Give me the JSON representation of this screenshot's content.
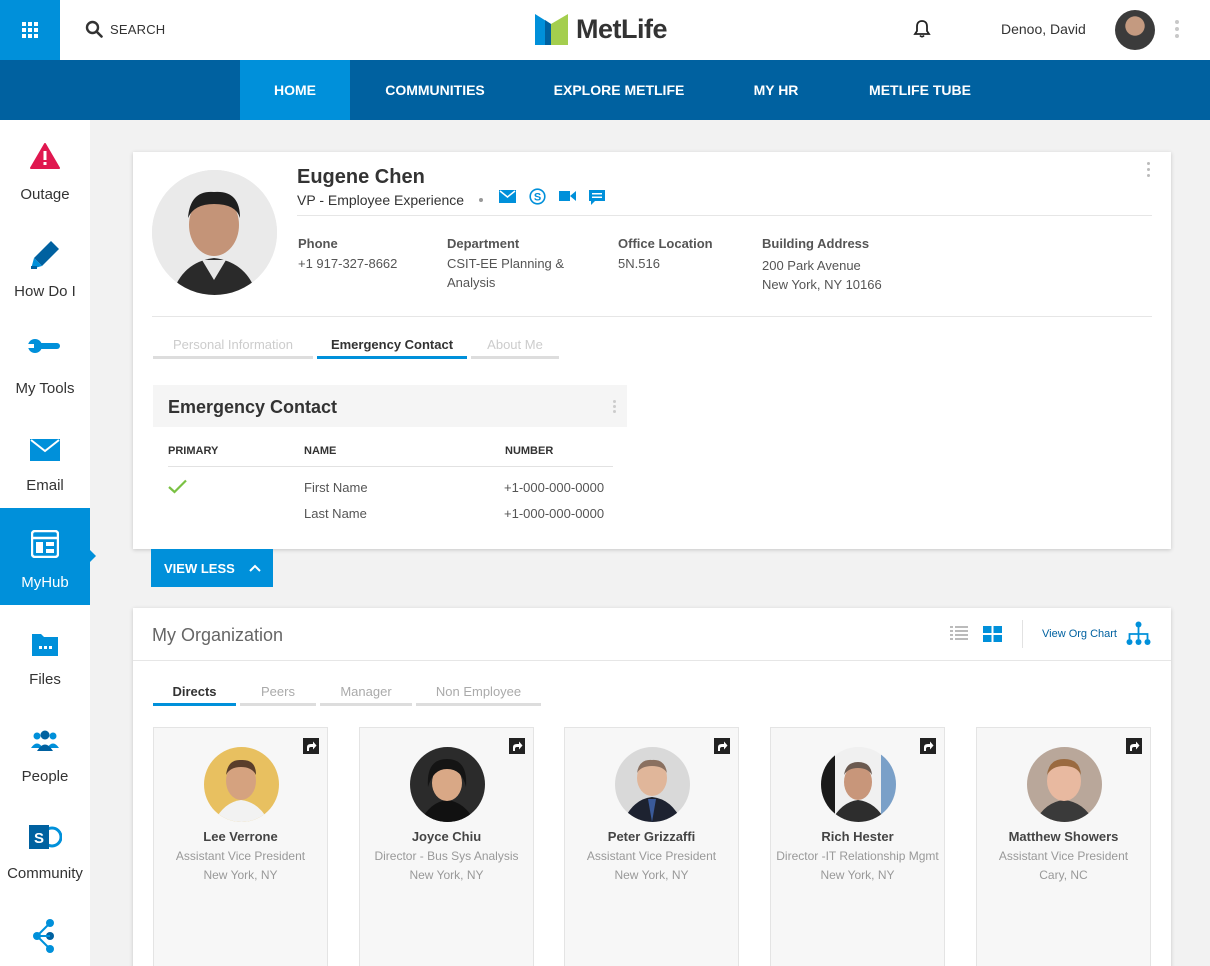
{
  "topbar": {
    "search_label": "SEARCH",
    "brand": "MetLife",
    "user_name": "Denoo, David"
  },
  "nav": {
    "items": [
      "HOME",
      "COMMUNITIES",
      "EXPLORE METLIFE",
      "MY HR",
      "METLIFE TUBE"
    ],
    "active": "HOME"
  },
  "sidebar": {
    "items": [
      {
        "label": "Outage",
        "icon": "warning-icon"
      },
      {
        "label": "How Do I",
        "icon": "pen-icon"
      },
      {
        "label": "My Tools",
        "icon": "wrench-icon"
      },
      {
        "label": "Email",
        "icon": "envelope-icon"
      },
      {
        "label": "MyHub",
        "icon": "hub-icon"
      },
      {
        "label": "Files",
        "icon": "folder-icon"
      },
      {
        "label": "People",
        "icon": "people-icon"
      },
      {
        "label": "Community",
        "icon": "sharepoint-icon"
      },
      {
        "label": "",
        "icon": "network-icon"
      }
    ],
    "active": "MyHub"
  },
  "profile": {
    "name": "Eugene Chen",
    "title": "VP - Employee Experience",
    "phone_label": "Phone",
    "phone": "+1 917-327-8662",
    "department_label": "Department",
    "department_line1": "CSIT-EE  Planning &",
    "department_line2": "Analysis",
    "office_label": "Office Location",
    "office": "5N.516",
    "building_label": "Building Address",
    "building_line1": "200 Park Avenue",
    "building_line2": "New York, NY  10166",
    "tabs": [
      "Personal Information",
      "Emergency Contact",
      "About Me"
    ],
    "active_tab": "Emergency Contact"
  },
  "emergency": {
    "title": "Emergency Contact",
    "headers": {
      "primary": "PRIMARY",
      "name": "NAME",
      "number": "NUMBER"
    },
    "rows": [
      {
        "primary": true,
        "name": "First Name",
        "number": "+1-000-000-0000"
      },
      {
        "primary": false,
        "name": "Last Name",
        "number": "+1-000-000-0000"
      }
    ]
  },
  "view_less_label": "VIEW LESS",
  "org": {
    "title": "My Organization",
    "view_org_chart": "View Org Chart",
    "tabs": [
      "Directs",
      "Peers",
      "Manager",
      "Non Employee"
    ],
    "active_tab": "Directs",
    "people": [
      {
        "name": "Lee Verrone",
        "title": "Assistant Vice President",
        "location": "New York, NY"
      },
      {
        "name": "Joyce Chiu",
        "title": "Director - Bus Sys Analysis",
        "location": "New York, NY"
      },
      {
        "name": "Peter Grizzaffi",
        "title": "Assistant Vice President",
        "location": "New York, NY"
      },
      {
        "name": "Rich Hester",
        "title": "Director -IT Relationship Mgmt",
        "location": "New York, NY"
      },
      {
        "name": "Matthew Showers",
        "title": "Assistant Vice President",
        "location": "Cary, NC"
      }
    ]
  },
  "colors": {
    "accent": "#0090da",
    "nav": "#0061a0",
    "brand_green": "#a4ce4e"
  }
}
